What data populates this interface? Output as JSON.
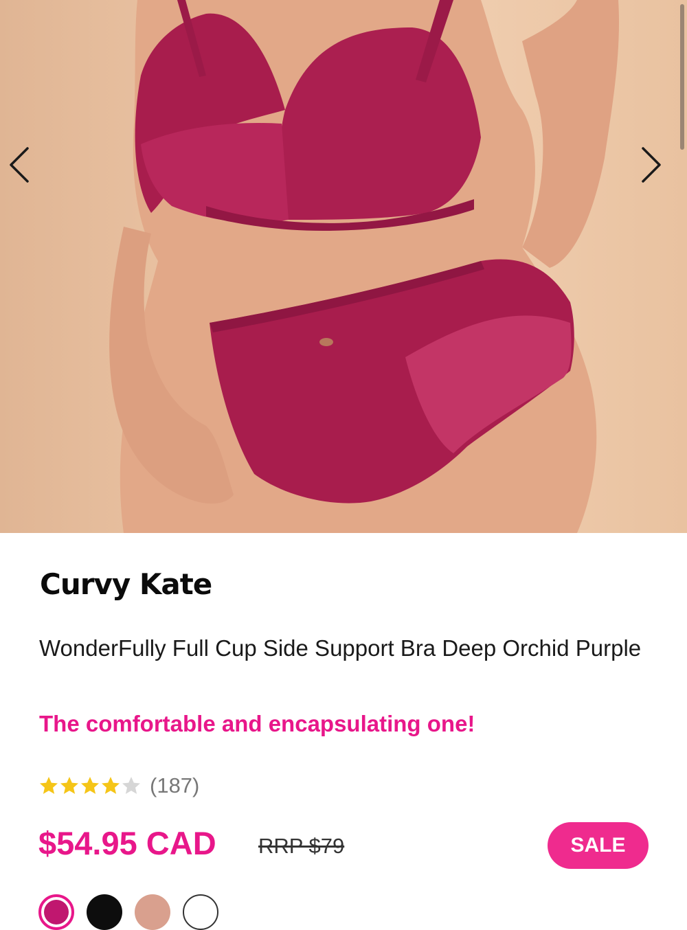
{
  "gallery": {
    "prev_icon": "chevron-left-icon",
    "next_icon": "chevron-right-icon"
  },
  "product": {
    "brand": "Curvy Kate",
    "title": "WonderFully Full Cup Side Support Bra Deep Orchid Purple",
    "tagline": "The comfortable and encapsulating one!",
    "rating": {
      "stars": 4,
      "max": 5,
      "count_text": "(187)"
    },
    "price": "$54.95 CAD",
    "rrp": "RRP $79",
    "badge": "SALE"
  },
  "swatches": [
    {
      "color": "#c0176f",
      "selected": true
    },
    {
      "color": "#0d0d0d",
      "selected": false
    },
    {
      "color": "#d9a08e",
      "selected": false
    },
    {
      "color": "#ffffff",
      "selected": false
    }
  ],
  "colors": {
    "accent": "#e8178a",
    "badge": "#ef2b8e",
    "star_filled": "#f5c518",
    "star_empty": "#d6d6d6"
  }
}
